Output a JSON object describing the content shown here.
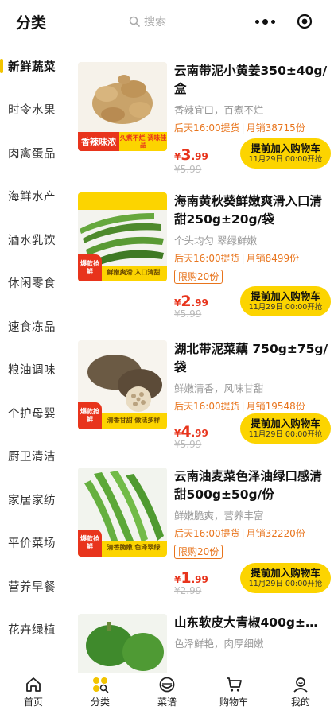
{
  "header": {
    "title": "分类",
    "search_placeholder": "搜索",
    "more_icon": "more-dots-icon",
    "target_icon": "record-target-icon"
  },
  "sidebar": {
    "items": [
      {
        "label": "新鲜蔬菜",
        "active": true
      },
      {
        "label": "时令水果"
      },
      {
        "label": "肉禽蛋品"
      },
      {
        "label": "海鲜水产"
      },
      {
        "label": "酒水乳饮"
      },
      {
        "label": "休闲零食"
      },
      {
        "label": "速食冻品"
      },
      {
        "label": "粮油调味"
      },
      {
        "label": "个护母婴"
      },
      {
        "label": "厨卫清洁"
      },
      {
        "label": "家居家纺"
      },
      {
        "label": "平价菜场"
      },
      {
        "label": "营养早餐"
      },
      {
        "label": "花卉绿植"
      }
    ]
  },
  "products": [
    {
      "name": "云南带泥小黄姜350±40g/盒",
      "desc": "香辣宜口，百煮不烂",
      "pickup": "后天16:00提货",
      "sales": "月销38715份",
      "limit": "",
      "price_currency": "¥",
      "price_int": "3",
      "price_dec": ".99",
      "old_price": "¥5.99",
      "btn_main": "提前加入购物车",
      "btn_sub": "11月29日 00:00开抢",
      "badge_a": "香辣味浓",
      "badge_b": "久煮不烂 调味佳品"
    },
    {
      "name": "海南黄秋葵鲜嫩爽滑入口清甜250g±20g/袋",
      "desc": "个头均匀 翠绿鲜嫩",
      "pickup": "后天16:00提货",
      "sales": "月销8499份",
      "limit": "限购20份",
      "price_currency": "¥",
      "price_int": "2",
      "price_dec": ".99",
      "old_price": "¥5.99",
      "btn_main": "提前加入购物车",
      "btn_sub": "11月29日 00:00开抢",
      "badge_a": "爆款抢鲜",
      "badge_b": "鲜嫩爽滑 入口清甜"
    },
    {
      "name": "湖北带泥菜藕 750g±75g/袋",
      "desc": "鲜嫩清香，风味甘甜",
      "pickup": "后天16:00提货",
      "sales": "月销19548份",
      "limit": "",
      "price_currency": "¥",
      "price_int": "4",
      "price_dec": ".99",
      "old_price": "¥5.99",
      "btn_main": "提前加入购物车",
      "btn_sub": "11月29日 00:00开抢",
      "badge_a": "爆款抢鲜",
      "badge_b": "清香甘甜 做法多样"
    },
    {
      "name": "云南油麦菜色泽油绿口感清甜500g±50g/份",
      "desc": "鲜嫩脆爽，营养丰富",
      "pickup": "后天16:00提货",
      "sales": "月销32220份",
      "limit": "限购20份",
      "price_currency": "¥",
      "price_int": "1",
      "price_dec": ".99",
      "old_price": "¥2.99",
      "btn_main": "提前加入购物车",
      "btn_sub": "11月29日 00:00开抢",
      "badge_a": "爆款抢鲜",
      "badge_b": "清香脆嫩 色泽翠绿"
    },
    {
      "name": "山东软皮大青椒400g±…",
      "desc": "色泽鲜艳，肉厚细嫩"
    }
  ],
  "tabbar": {
    "items": [
      {
        "label": "首页",
        "icon": "home-icon"
      },
      {
        "label": "分类",
        "icon": "category-icon",
        "active": true
      },
      {
        "label": "菜谱",
        "icon": "recipe-bowl-icon"
      },
      {
        "label": "购物车",
        "icon": "cart-icon"
      },
      {
        "label": "我的",
        "icon": "profile-icon"
      }
    ]
  },
  "colors": {
    "accent_yellow": "#fcd400",
    "price_red": "#e8341c",
    "meta_orange": "#e8741c"
  }
}
